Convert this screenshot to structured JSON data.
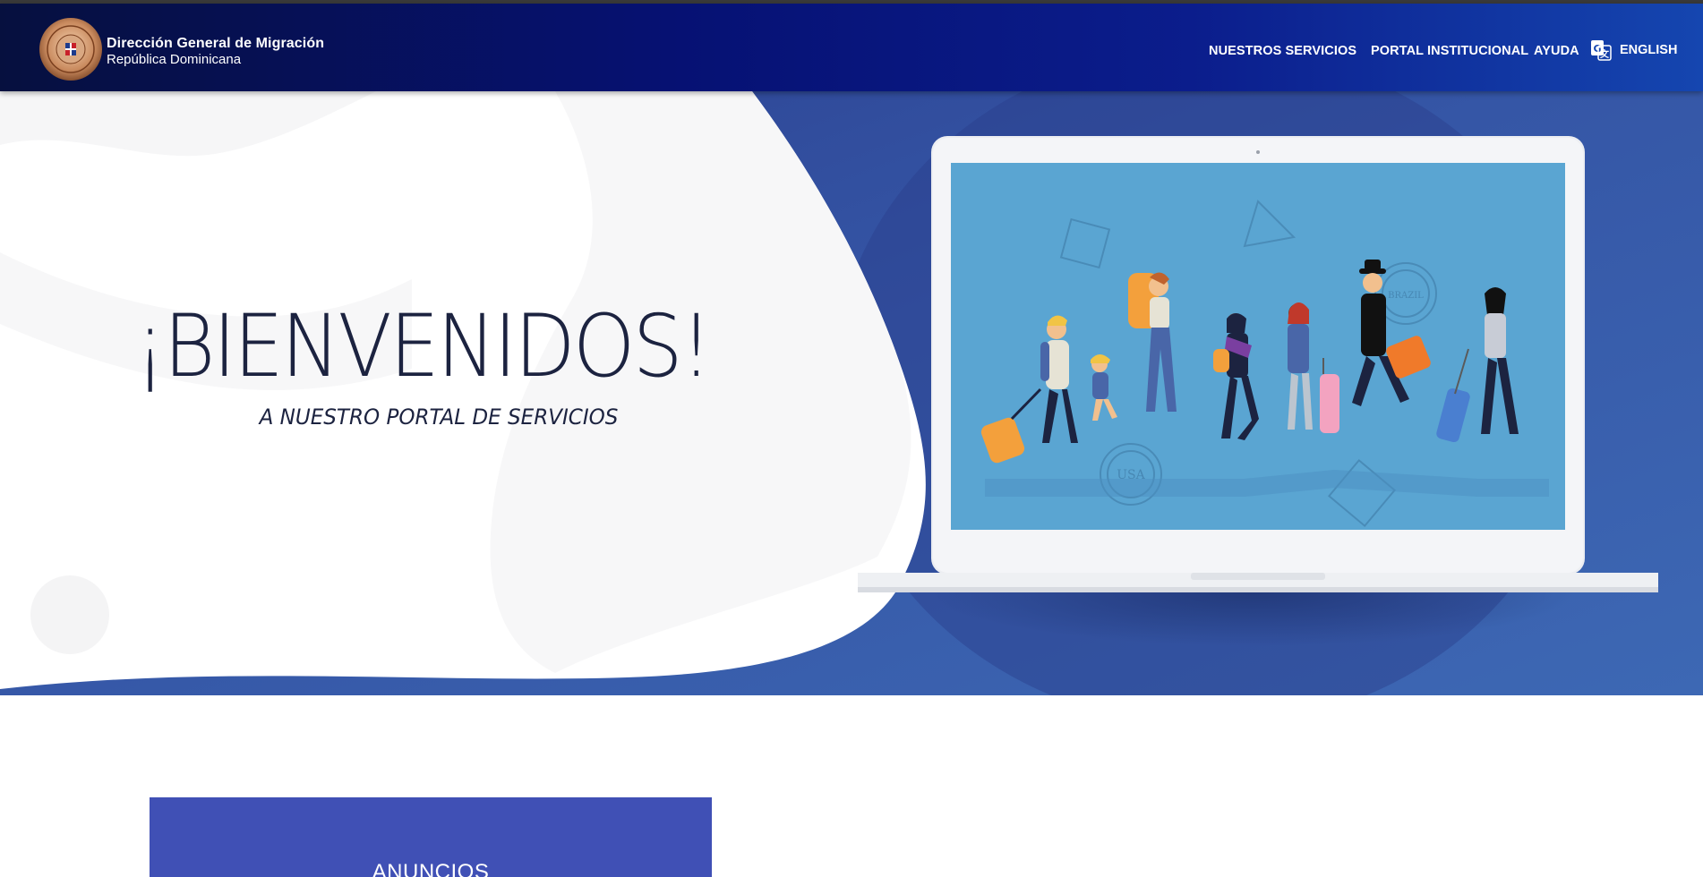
{
  "header": {
    "title": "Dirección General de Migración",
    "subtitle": "República Dominicana",
    "nav": {
      "services": "NUESTROS SERVICIOS",
      "portal": "PORTAL INSTITUCIONAL",
      "help": "AYUDA",
      "language": "ENGLISH"
    },
    "logo_icon": "seal-logo-icon",
    "language_icon": "translate-icon"
  },
  "hero": {
    "title": "¡BIENVENIDOS!",
    "subtitle": "A NUESTRO PORTAL DE SERVICIOS",
    "illustration": "laptop-travelers-illustration",
    "stamps": {
      "usa": "USA",
      "brazil": "BRAZIL"
    }
  },
  "announcements": {
    "title": "ANUNCIOS"
  },
  "colors": {
    "header_dark": "#06103f",
    "header_light": "#1546b0",
    "hero_blue": "#3a5aa8",
    "title_text": "#1c2340",
    "announce_bg": "#4050b5",
    "screen_blue": "#5aa5d2"
  }
}
